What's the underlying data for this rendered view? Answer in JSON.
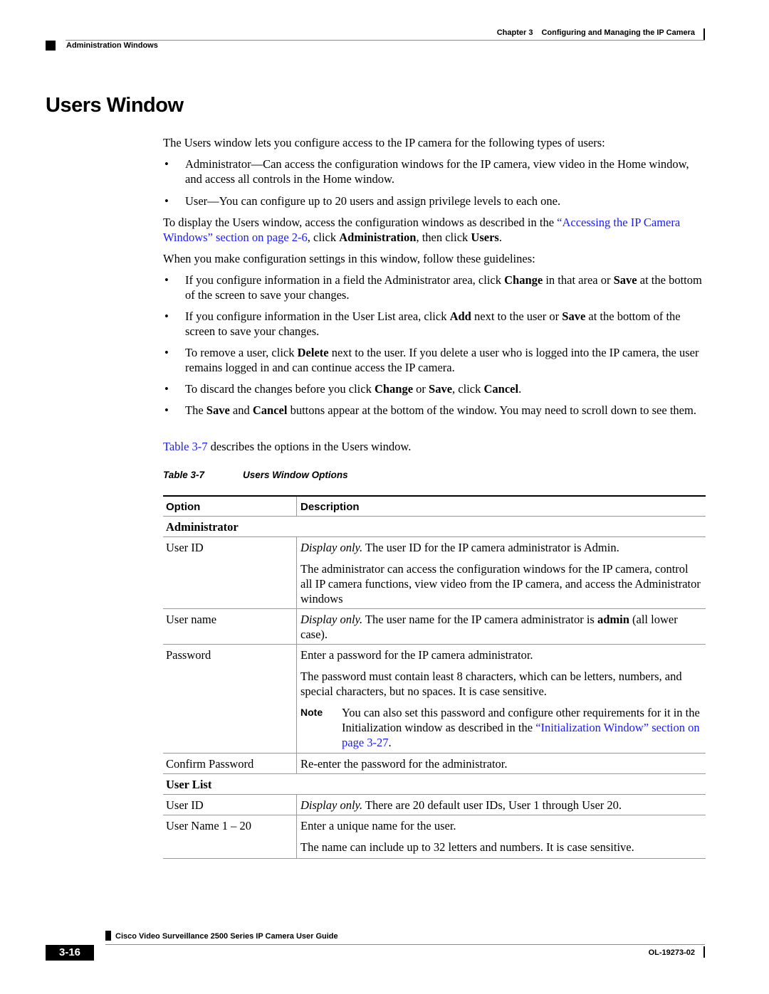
{
  "header": {
    "chapter_label": "Chapter 3",
    "chapter_title": "Configuring and Managing the IP Camera",
    "section": "Administration Windows"
  },
  "title": "Users Window",
  "intro": "The Users window lets you configure access to the IP camera for the following types of users:",
  "user_types": [
    {
      "term": "Administrator",
      "text": "—Can access the configuration windows for the IP camera, view video in the Home window, and access all controls in the Home window."
    },
    {
      "term": "User",
      "text": "—You can configure up to 20 users and assign privilege levels to each one."
    }
  ],
  "display_para": {
    "pre": "To display the Users window, access the configuration windows as described in the ",
    "link": "“Accessing the IP Camera Windows” section on page 2-6",
    "mid": ", click ",
    "b1": "Administration",
    "mid2": ", then click ",
    "b2": "Users",
    "end": "."
  },
  "guidelines_intro": "When you make configuration settings in this window, follow these guidelines:",
  "guidelines": [
    {
      "parts": [
        "If you configure information in a field the Administrator area, click ",
        "Change",
        " in that area or ",
        "Save",
        " at the bottom of the screen to save your changes."
      ]
    },
    {
      "parts": [
        "If you configure information in the User List area, click ",
        "Add",
        " next to the user or ",
        "Save",
        " at the bottom of the screen to save your changes."
      ]
    },
    {
      "parts": [
        "To remove a user, click ",
        "Delete",
        " next to the user. If you delete a user who is logged into the IP camera, the user remains logged in and can continue access the IP camera.",
        "",
        ""
      ]
    },
    {
      "parts": [
        "To discard the changes before you click ",
        "Change",
        " or ",
        "Save",
        ", click ",
        "Cancel",
        "."
      ]
    },
    {
      "parts": [
        "The ",
        "Save",
        " and ",
        "Cancel",
        " buttons appear at the bottom of the window. You may need to scroll down to see them."
      ]
    }
  ],
  "table_ref": {
    "link": "Table 3-7",
    "text": " describes the options in the Users window."
  },
  "table": {
    "caption_num": "Table 3-7",
    "caption_title": "Users Window Options",
    "headers": [
      "Option",
      "Description"
    ],
    "groups": [
      {
        "name": "Administrator",
        "rows": [
          {
            "option": "User ID",
            "desc": [
              {
                "italic": "Display only.",
                "text": " The user ID for the IP camera administrator is Admin."
              },
              {
                "text": "The administrator can access the configuration windows for the IP camera, control all IP camera functions, view video from the IP camera, and access the Administrator windows"
              }
            ]
          },
          {
            "option": "User name",
            "desc": [
              {
                "italic": "Display only.",
                "text": " The user name for the IP camera administrator is ",
                "bold": "admin",
                "tail": " (all lower case)."
              }
            ]
          },
          {
            "option": "Password",
            "desc": [
              {
                "text": "Enter a password for the IP camera administrator."
              },
              {
                "text": "The password must contain least 8 characters, which can be letters, numbers, and special characters, but no spaces. It is case sensitive."
              }
            ],
            "note": {
              "label": "Note",
              "text": "You can also set this password and configure other requirements for it in the Initialization window as described in the ",
              "link": "“Initialization Window” section on page 3-27",
              "end": "."
            }
          },
          {
            "option": "Confirm Password",
            "desc": [
              {
                "text": "Re-enter the password for the administrator."
              }
            ]
          }
        ]
      },
      {
        "name": "User List",
        "rows": [
          {
            "option": "User ID",
            "desc": [
              {
                "italic": "Display only.",
                "text": " There are 20 default user IDs, User 1 through User 20."
              }
            ]
          },
          {
            "option": "User Name 1 – 20",
            "desc": [
              {
                "text": "Enter a unique name for the user."
              },
              {
                "text": "The name can include up to 32 letters and numbers. It is case sensitive."
              }
            ]
          }
        ]
      }
    ]
  },
  "footer": {
    "guide_title": "Cisco Video Surveillance 2500 Series IP Camera User Guide",
    "page_number": "3-16",
    "doc_id": "OL-19273-02"
  }
}
